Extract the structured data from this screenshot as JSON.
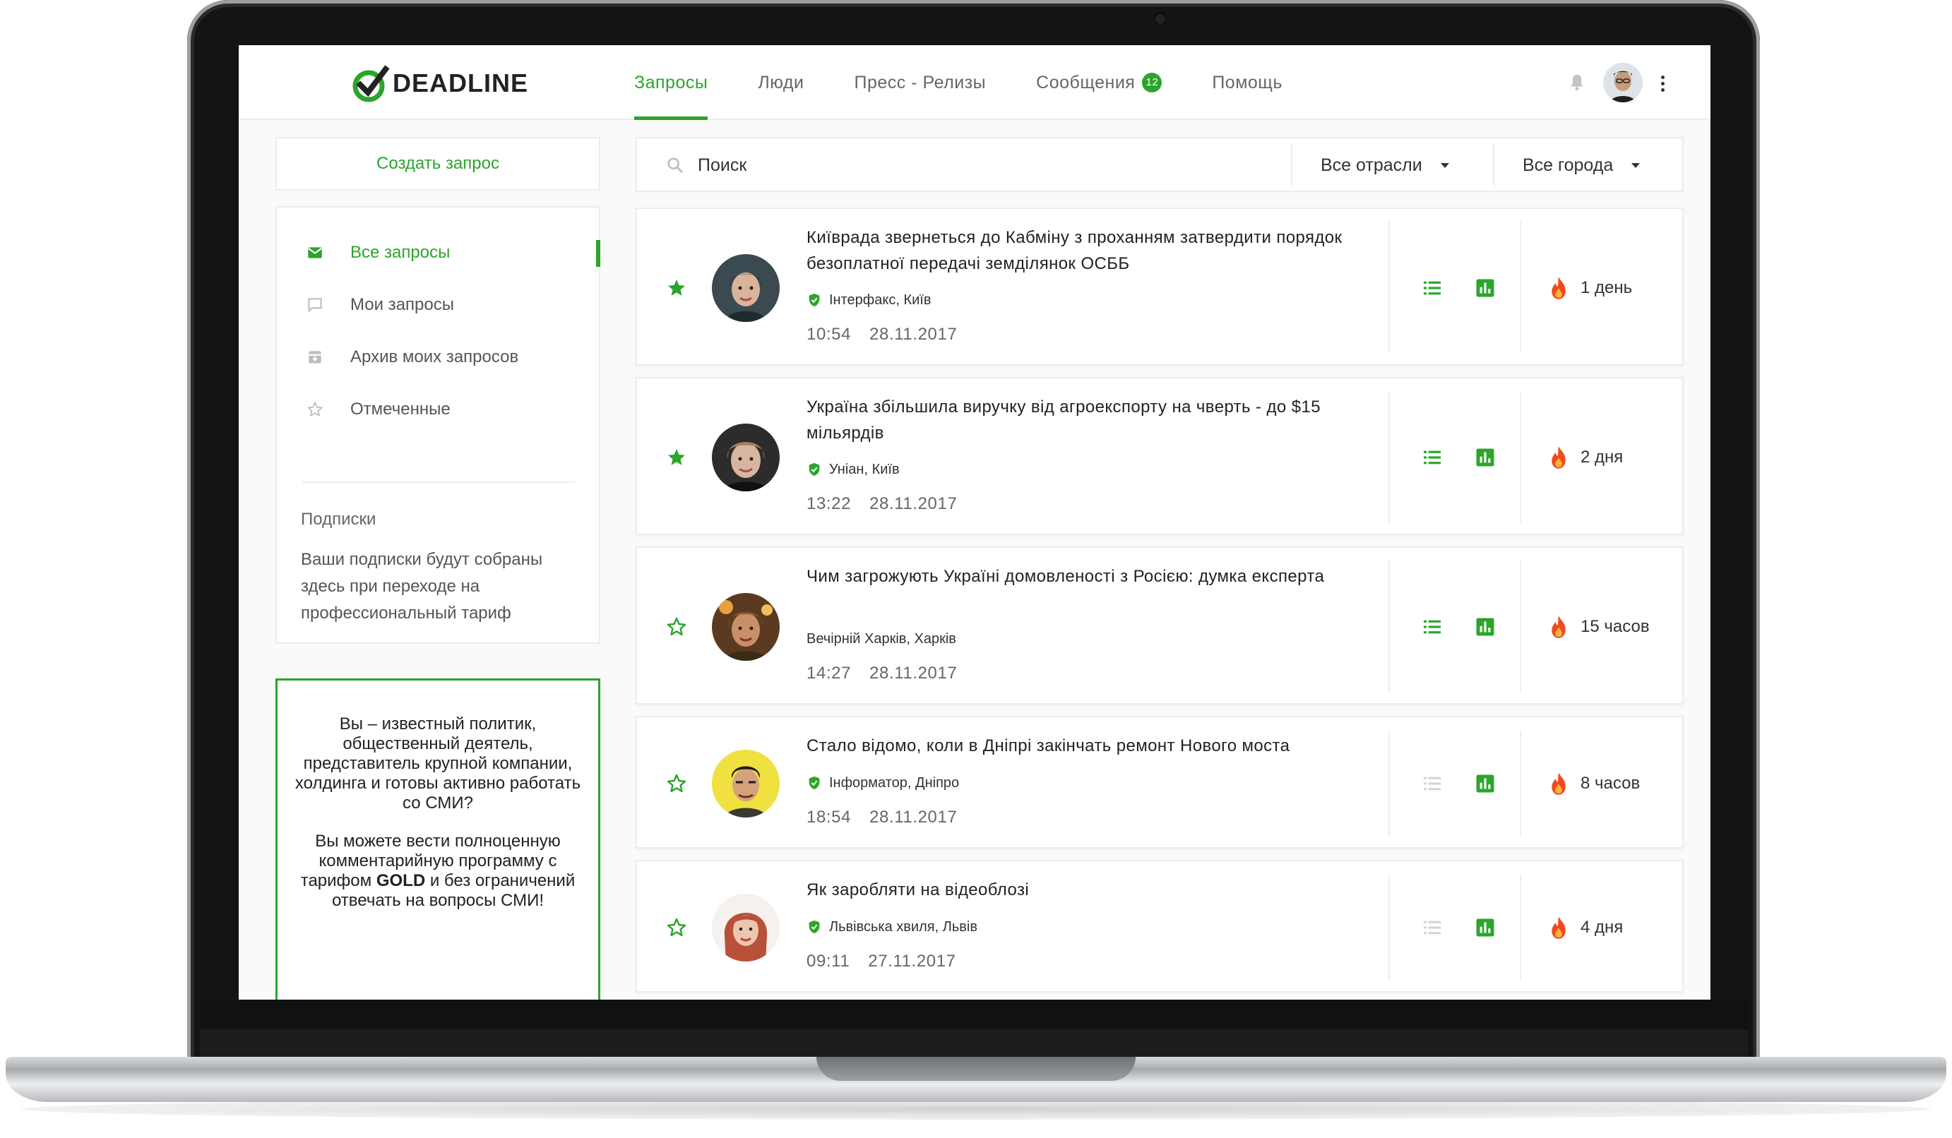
{
  "brand": {
    "name": "DEADLINE",
    "accent": "#2ba52b"
  },
  "nav": [
    {
      "label": "Запросы",
      "active": true
    },
    {
      "label": "Люди"
    },
    {
      "label": "Пресс - Релизы"
    },
    {
      "label": "Сообщения",
      "badge": "12"
    },
    {
      "label": "Помощь"
    }
  ],
  "header": {
    "icons": [
      "bell-icon",
      "avatar",
      "more-vert-icon"
    ]
  },
  "sidebar": {
    "create_label": "Создать запрос",
    "items": [
      {
        "label": "Все запросы",
        "icon": "mail-icon",
        "active": true
      },
      {
        "label": "Мои запросы",
        "icon": "comment-icon"
      },
      {
        "label": "Архив моих запросов",
        "icon": "archive-icon"
      },
      {
        "label": "Отмеченные",
        "icon": "star-outline-icon"
      }
    ],
    "subscriptions_title": "Подписки",
    "subscriptions_text": "Ваши подписки будут собраны здесь при переходе на профессиональный тариф"
  },
  "promo": {
    "line1": "Вы – известный политик, общественный деятель, представитель крупной компании, холдинга и готовы активно работать со СМИ?",
    "line2_before": "Вы можете вести полноценную комментарийную программу с тарифом",
    "line2_bold": "GOLD",
    "line2_after": "и без ограничений отвечать на вопросы СМИ!"
  },
  "search": {
    "placeholder": "Поиск",
    "filters": [
      "Все отрасли",
      "Все города"
    ]
  },
  "requests": [
    {
      "title": "Київрада звернеться до Кабміну з проханням затвердити порядок безоплатної передачі земділянок ОСББ",
      "source": "Інтерфакс, Київ",
      "verified": true,
      "time": "10:54",
      "date": "28.11.2017",
      "deadline": "1 день",
      "starred": true,
      "list_active": true
    },
    {
      "title": "Україна збільшила виручку від агроекспорту на чверть - до $15 мільярдів",
      "source": "Уніан, Київ",
      "verified": true,
      "time": "13:22",
      "date": "28.11.2017",
      "deadline": "2 дня",
      "starred": true,
      "list_active": true
    },
    {
      "title": "Чим загрожують Україні домовленості з Росією: думка експерта",
      "source": "Вечірній Харків, Харків",
      "verified": false,
      "time": "14:27",
      "date": "28.11.2017",
      "deadline": "15 часов",
      "starred": false,
      "list_active": true
    },
    {
      "title": "Стало відомо, коли в Дніпрі закінчать ремонт Нового моста",
      "source": "Інформатор, Дніпро",
      "verified": true,
      "time": "18:54",
      "date": "28.11.2017",
      "deadline": "8 часов",
      "starred": false,
      "list_active": false
    },
    {
      "title": "Як заробляти на відеоблозі",
      "source": "Львівська хвиля, Львів",
      "verified": true,
      "time": "09:11",
      "date": "27.11.2017",
      "deadline": "4 дня",
      "starred": false,
      "list_active": false
    }
  ]
}
